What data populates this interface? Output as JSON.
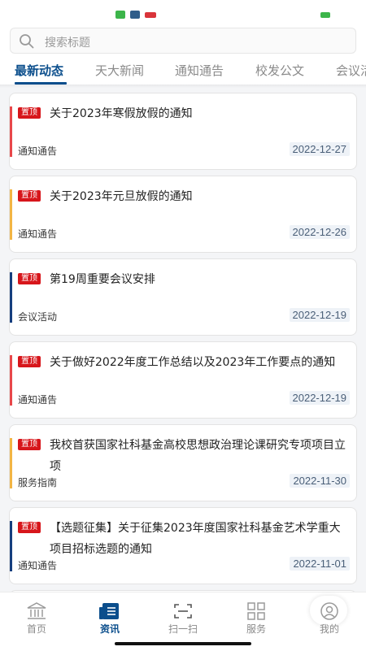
{
  "search": {
    "placeholder": "搜索标题"
  },
  "tabs": [
    {
      "label": "最新动态",
      "active": true
    },
    {
      "label": "天大新闻",
      "active": false
    },
    {
      "label": "通知通告",
      "active": false
    },
    {
      "label": "校发公文",
      "active": false
    },
    {
      "label": "会议活",
      "active": false
    }
  ],
  "colors": {
    "accent": "#0b4e8c",
    "badge": "#d7161b",
    "bar_red": "#e8474a",
    "bar_orange": "#f2b544",
    "bar_navy": "#153e7e"
  },
  "news": [
    {
      "badge": "置顶",
      "title": "关于2023年寒假放假的通知",
      "category": "通知通告",
      "date": "2022-12-27",
      "bar_color": "#e8474a"
    },
    {
      "badge": "置顶",
      "title": "关于2023年元旦放假的通知",
      "category": "通知通告",
      "date": "2022-12-26",
      "bar_color": "#f2b544"
    },
    {
      "badge": "置顶",
      "title": "第19周重要会议安排",
      "category": "会议活动",
      "date": "2022-12-19",
      "bar_color": "#153e7e"
    },
    {
      "badge": "置顶",
      "title": "关于做好2022年度工作总结以及2023年工作要点的通知",
      "category": "通知通告",
      "date": "2022-12-19",
      "bar_color": "#e8474a"
    },
    {
      "badge": "置顶",
      "title": "我校首获国家社科基金高校思想政治理论课研究专项项目立项",
      "category": "服务指南",
      "date": "2022-11-30",
      "bar_color": "#f2b544"
    },
    {
      "badge": "置顶",
      "title": "【选题征集】关于征集2023年度国家社科基金艺术学重大项目招标选题的通知",
      "category": "通知通告",
      "date": "2022-11-01",
      "bar_color": "#153e7e"
    }
  ],
  "nav": [
    {
      "label": "首页",
      "icon": "building-icon",
      "active": false
    },
    {
      "label": "资讯",
      "icon": "news-icon",
      "active": true
    },
    {
      "label": "扫一扫",
      "icon": "scan-icon",
      "active": false
    },
    {
      "label": "服务",
      "icon": "grid-icon",
      "active": false
    },
    {
      "label": "我的",
      "icon": "user-icon",
      "active": false
    }
  ]
}
